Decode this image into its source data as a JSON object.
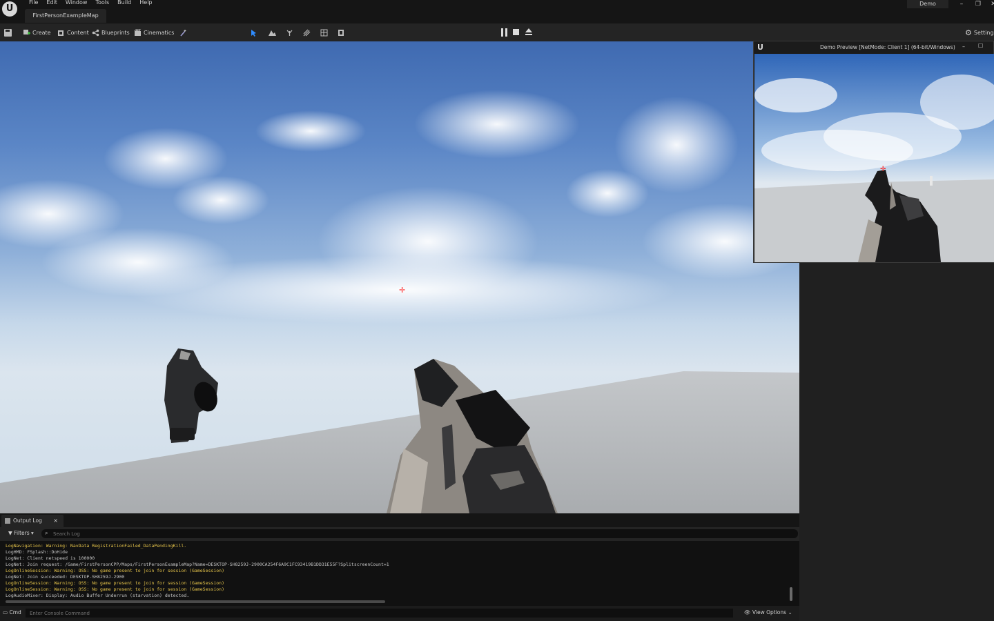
{
  "app": {
    "project_name": "Demo",
    "map_tab": "FirstPersonExampleMap"
  },
  "menu": [
    "File",
    "Edit",
    "Window",
    "Tools",
    "Build",
    "Help"
  ],
  "window_controls": [
    "–",
    "❐",
    "✕"
  ],
  "toolbar": {
    "create": "Create",
    "content": "Content",
    "blueprints": "Blueprints",
    "cinematics": "Cinematics",
    "settings": "Settings"
  },
  "preview": {
    "title": "Demo Preview [NetMode: Client 1]  (64-bit/Windows)",
    "controls": [
      "–",
      "☐"
    ]
  },
  "output_log": {
    "tab_label": "Output Log",
    "close": "×",
    "filters_label": "Filters",
    "search_placeholder": "Search Log",
    "lines": [
      {
        "level": "warn",
        "text": "LogNavigation: Warning: NavData RegistrationFailed_DataPendingKill."
      },
      {
        "level": "info",
        "text": "LogHMD: FSplash::DoHide"
      },
      {
        "level": "info",
        "text": "LogNet: Client netspeed is 100000"
      },
      {
        "level": "info",
        "text": "LogNet: Join request: /Game/FirstPersonCPP/Maps/FirstPersonExampleMap?Name=DESKTOP-SH8259J-2900CA254F6A9C1FC93419B1DD31E55F?SplitscreenCount=1"
      },
      {
        "level": "warn",
        "text": "LogOnlineSession: Warning: OSS: No game present to join for session (GameSession)"
      },
      {
        "level": "info",
        "text": "LogNet: Join succeeded: DESKTOP-SH8259J-2900"
      },
      {
        "level": "warn",
        "text": "LogOnlineSession: Warning: OSS: No game present to join for session (GameSession)"
      },
      {
        "level": "warn",
        "text": "LogOnlineSession: Warning: OSS: No game present to join for session (GameSession)"
      },
      {
        "level": "info",
        "text": "LogAudioMixer: Display: Audio Buffer Underrun (starvation) detected."
      }
    ],
    "cmd_label": "Cmd",
    "cmd_placeholder": "Enter Console Command",
    "view_options": "View Options"
  },
  "colors": {
    "warning": "#e8c64b",
    "info": "#c6c6c6",
    "crosshair": "#ff2a2a",
    "accent": "#2f8cff"
  }
}
